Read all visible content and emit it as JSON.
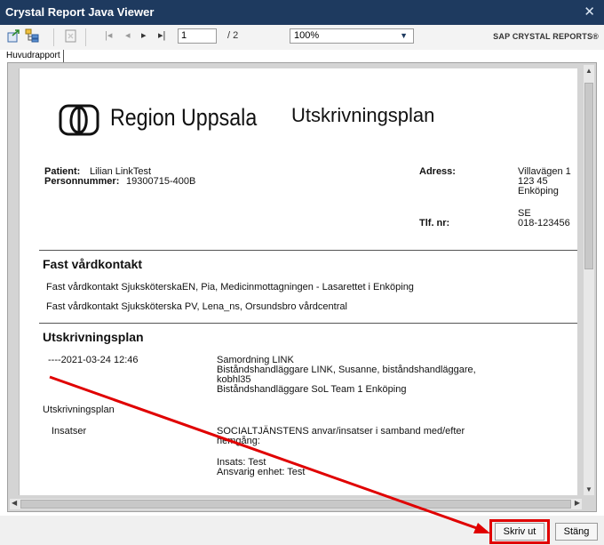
{
  "window": {
    "title": "Crystal Report Java Viewer",
    "close_glyph": "✕"
  },
  "toolbar": {
    "page_value": "1",
    "page_of": "/ 2",
    "zoom_value": "100%",
    "brand": "SAP CRYSTAL REPORTS®",
    "icons": [
      "export-icon",
      "group-tree-icon",
      "print-setup-icon",
      "first-page-icon",
      "prev-page-icon",
      "next-page-icon",
      "last-page-icon"
    ]
  },
  "tabs": {
    "main": "Huvudrapport"
  },
  "report": {
    "logo_text": "Region Uppsala",
    "title": "Utskrivningsplan",
    "patient_label": "Patient:",
    "patient_value": "Lilian LinkTest",
    "pnr_label": "Personnummer:",
    "pnr_value": "19300715-400B",
    "address_label": "Adress:",
    "address_lines": [
      "Villavägen 1",
      "123 45",
      "Enköping",
      "",
      "SE"
    ],
    "phone_label": "Tlf. nr:",
    "phone_value": "018-123456",
    "section1_title": "Fast vårdkontakt",
    "contacts": [
      "Fast vårdkontakt SjuksköterskaEN, Pia, Medicinmottagningen - Lasarettet i Enköping",
      "Fast vårdkontakt Sjuksköterska PV, Lena_ns, Orsundsbro vårdcentral"
    ],
    "section2_title": "Utskrivningsplan",
    "entry_date": "----2021-03-24 12:46",
    "entry_lines": [
      "Samordning LINK",
      "Biståndshandläggare LINK, Susanne, biståndshandläggare,",
      "kobhl35",
      "Biståndshandläggare SoL Team 1 Enköping"
    ],
    "plan_label": "Utskrivningsplan",
    "insatser_label": "Insatser",
    "insatser_lines": [
      "SOCIALTJÄNSTENS anvar/insatser i samband med/efter",
      "hemgång:",
      "",
      "Insats: Test",
      "Ansvarig enhet: Test"
    ]
  },
  "footer": {
    "print_label": "Skriv ut",
    "close_label": "Stäng"
  },
  "annotation": {
    "color": "#e00000"
  }
}
